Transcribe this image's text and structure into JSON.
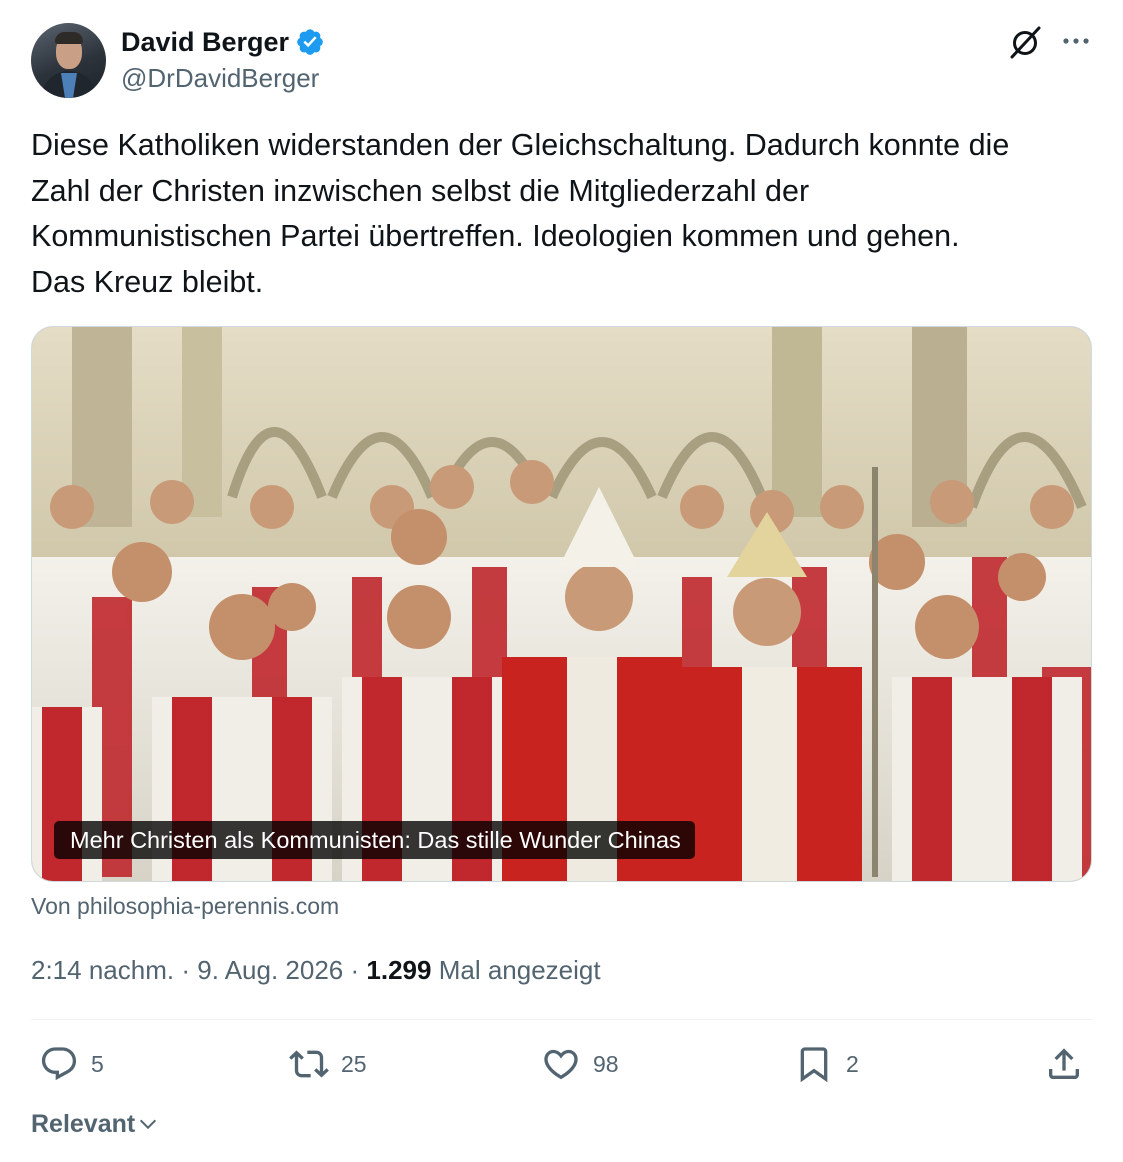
{
  "author": {
    "display_name": "David Berger",
    "handle": "@DrDavidBerger",
    "verified": true,
    "avatar_icon": "profile-photo"
  },
  "header_icons": {
    "grok": "grok-icon",
    "more": "more-options-icon"
  },
  "tweet": {
    "text": "Diese Katholiken widerstanden der Gleichschaltung. Dadurch konnte die\nZahl der Christen inzwischen selbst die Mitgliederzahl der\nKommunistischen Partei übertreffen. Ideologien kommen und gehen.\nDas Kreuz bleibt."
  },
  "link_card": {
    "title": "Mehr Christen als Kommunisten: Das stille Wunder Chinas",
    "source": "Von philosophia-perennis.com"
  },
  "meta": {
    "time": "2:14 nachm.",
    "separator": "·",
    "date": "9. Aug. 2026",
    "views_count": "1.299",
    "views_label": "Mal angezeigt"
  },
  "actions": {
    "replies": "5",
    "reposts": "25",
    "likes": "98",
    "bookmarks": "2"
  },
  "sort": {
    "label": "Relevant"
  },
  "colors": {
    "text_primary": "#0f1419",
    "text_secondary": "#536471",
    "verified_blue": "#1d9bf0",
    "border": "#cfd9de"
  }
}
